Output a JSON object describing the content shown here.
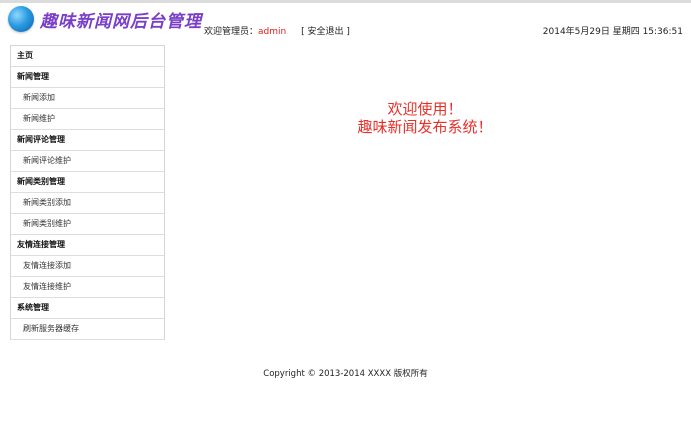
{
  "header": {
    "logo_text": "趣味新闻网后台管理",
    "welcome_label": "欢迎管理员：",
    "username": "admin",
    "logout_label": "[ 安全退出 ]",
    "datetime": "2014年5月29日 星期四 15:36:51"
  },
  "sidebar": {
    "home": "主页",
    "news_group": "新闻管理",
    "news_add": "新闻添加",
    "news_maintain": "新闻维护",
    "comment_group": "新闻评论管理",
    "comment_maintain": "新闻评论维护",
    "category_group": "新闻类别管理",
    "category_add": "新闻类别添加",
    "category_maintain": "新闻类别维护",
    "link_group": "友情连接管理",
    "link_add": "友情连接添加",
    "link_maintain": "友情连接维护",
    "system_group": "系统管理",
    "refresh_cache": "刷新服务器缓存"
  },
  "main": {
    "welcome_line1": "欢迎使用！",
    "welcome_line2": "趣味新闻发布系统！"
  },
  "footer": {
    "copyright": "Copyright © 2013-2014 XXXX 版权所有"
  },
  "colors": {
    "accent_red": "#e8302a",
    "logo_purple": "#7a3fc8",
    "logo_blue": "#2a9be0"
  }
}
